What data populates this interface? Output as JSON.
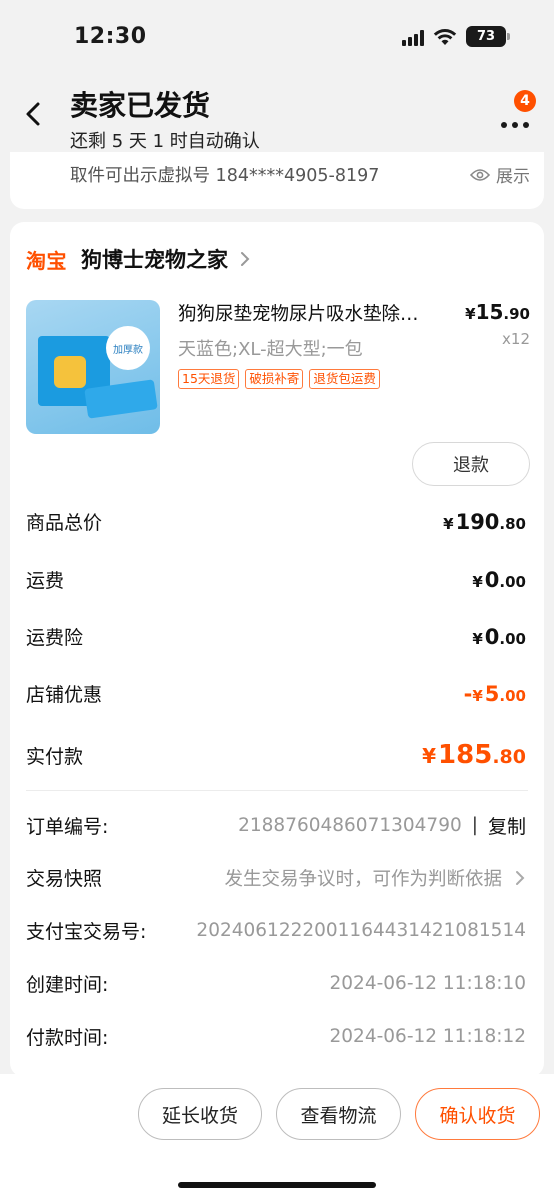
{
  "status_bar": {
    "time": "12:30",
    "battery": "73"
  },
  "header": {
    "title": "卖家已发货",
    "subtitle": "还剩 5 天 1 时自动确认",
    "message_badge": "4"
  },
  "pickup": {
    "text": "取件可出示虚拟号 184****4905-8197",
    "show_label": "展示"
  },
  "shop": {
    "platform_logo": "淘宝",
    "name": "狗博士宠物之家"
  },
  "product": {
    "title": "狗狗尿垫宠物尿片吸水垫除…",
    "price_symbol": "¥",
    "price_int": "15",
    "price_dec": ".90",
    "quantity": "x12",
    "spec": "天蓝色;XL-超大型;一包",
    "tags": [
      "15天退货",
      "破损补寄",
      "退货包运费"
    ],
    "thumbnail_badge": "加厚款",
    "refund_label": "退款"
  },
  "summary": [
    {
      "label": "商品总价",
      "sign": "",
      "cur": "¥",
      "int": "190",
      "dec": ".80"
    },
    {
      "label": "运费",
      "sign": "",
      "cur": "¥",
      "int": "0",
      "dec": ".00"
    },
    {
      "label": "运费险",
      "sign": "",
      "cur": "¥",
      "int": "0",
      "dec": ".00"
    },
    {
      "label": "店铺优惠",
      "sign": "-",
      "cur": "¥",
      "int": "5",
      "dec": ".00"
    },
    {
      "label": "实付款",
      "sign": "",
      "cur": "¥",
      "int": "185",
      "dec": ".80"
    }
  ],
  "order_info": {
    "order_no_label": "订单编号:",
    "order_no": "2188760486071304790",
    "copy_label": "复制",
    "snapshot_label": "交易快照",
    "snapshot_text": "发生交易争议时，可作为判断依据",
    "alipay_label": "支付宝交易号:",
    "alipay_no": "2024061222001164431421081514",
    "created_label": "创建时间:",
    "created_at": "2024-06-12 11:18:10",
    "paid_label": "付款时间:",
    "paid_at": "2024-06-12 11:18:12"
  },
  "actions": {
    "extend_label": "延长收货",
    "logistics_label": "查看物流",
    "confirm_label": "确认收货"
  },
  "colors": {
    "accent": "#ff5000",
    "background": "#f2f2f2"
  }
}
